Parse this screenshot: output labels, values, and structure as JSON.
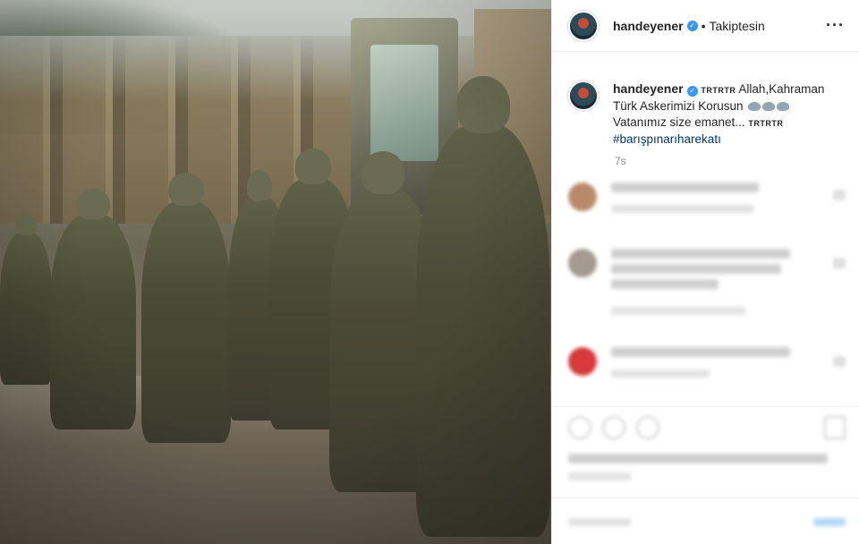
{
  "post": {
    "image_description_icon": "photo-icon"
  },
  "header": {
    "username": "handeyener",
    "verified_glyph": "✓",
    "separator": "•",
    "follow_status": "Takiptesin",
    "more_glyph": "···"
  },
  "caption": {
    "username": "handeyener",
    "verified_glyph": "✓",
    "prefix": "TRTRTR",
    "text_line1": " Allah,Kahraman",
    "text_line2": "Türk Askerimizi Korusun ",
    "text_line3": "Vatanımız size emanet... ",
    "suffix": "TRTRTR",
    "hashtag": "#barışpınarıharekatı"
  },
  "timestamp": "7s",
  "colors": {
    "link": "#00376b",
    "verified": "#3897f0",
    "muted": "#8e8e8e"
  }
}
